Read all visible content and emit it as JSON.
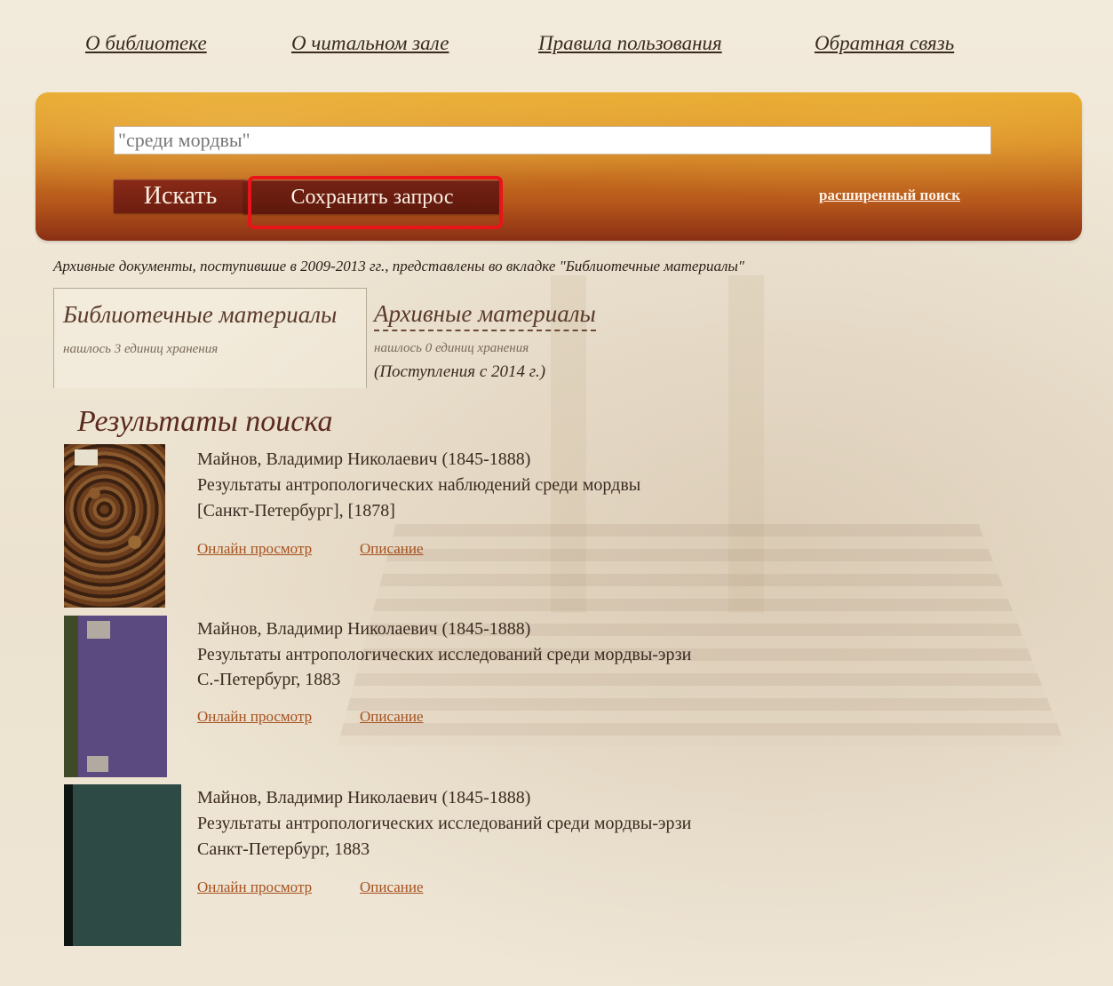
{
  "nav": {
    "items": [
      "О библиотеке",
      "О читальном зале",
      "Правила пользования",
      "Обратная связь"
    ]
  },
  "search": {
    "query": "\"среди мордвы\"",
    "search_button": "Искать",
    "save_button": "Сохранить запрос",
    "advanced_link": "расширенный поиск"
  },
  "notice": "Архивные документы, поступившие в 2009-2013 гг., представлены во вкладке \"Библиотечные материалы\"",
  "tabs": [
    {
      "title": "Библиотечные материалы",
      "count": "нашлось 3 единиц хранения"
    },
    {
      "title": "Архивные материалы",
      "count": "нашлось 0 единиц хранения",
      "note": "(Поступления с 2014 г.)"
    }
  ],
  "results": {
    "title": "Результаты поиска",
    "items": [
      {
        "author": "Майнов, Владимир Николаевич (1845-1888)",
        "title": "Результаты антропологических наблюдений среди мордвы",
        "imprint": "[Санкт-Петербург], [1878]",
        "online_link": "Онлайн просмотр",
        "desc_link": "Описание"
      },
      {
        "author": "Майнов, Владимир Николаевич (1845-1888)",
        "title": "Результаты антропологических исследований среди мордвы-эрзи",
        "imprint": "С.-Петербург, 1883",
        "online_link": "Онлайн просмотр",
        "desc_link": "Описание"
      },
      {
        "author": "Майнов, Владимир Николаевич (1845-1888)",
        "title": "Результаты антропологических исследований среди мордвы-эрзи",
        "imprint": "Санкт-Петербург, 1883",
        "online_link": "Онлайн просмотр",
        "desc_link": "Описание"
      }
    ]
  },
  "colors": {
    "banner_top": "#e6a629",
    "banner_bottom": "#8a2f14",
    "button": "#7a2414",
    "highlight": "#e8141a",
    "link": "#a5501e"
  }
}
